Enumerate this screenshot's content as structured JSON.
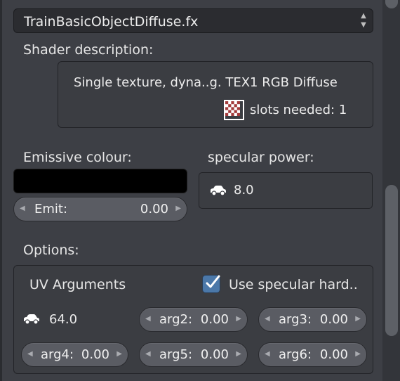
{
  "shader_dropdown": {
    "selected": "TrainBasicObjectDiffuse.fx",
    "arrows_up": "▲",
    "arrows_down": "▼"
  },
  "shader_description": {
    "label": "Shader description:",
    "text": "Single texture, dyna..g. TEX1 RGB Diffuse",
    "slots_text": "slots needed: 1"
  },
  "emissive": {
    "label": "Emissive colour:",
    "color": "#000000",
    "emit_label": "Emit:",
    "emit_value": "0.00"
  },
  "specular_power": {
    "label": "specular power:",
    "value": "8.0",
    "icon": "car-icon"
  },
  "options": {
    "label": "Options:",
    "uv_arguments_label": "UV Arguments",
    "use_specular_label": "Use specular hard..",
    "use_specular_checked": true,
    "arg1_value": "64.0",
    "arg2": {
      "label": "arg2:",
      "value": "0.00"
    },
    "arg3": {
      "label": "arg3:",
      "value": "0.00"
    },
    "arg4": {
      "label": "arg4:",
      "value": "0.00"
    },
    "arg5": {
      "label": "arg5:",
      "value": "0.00"
    },
    "arg6": {
      "label": "arg6:",
      "value": "0.00"
    }
  },
  "colors": {
    "panel_bg": "#3d3f45",
    "accent_checkbox": "#4b78a9",
    "pill_bg": "#5a5c63"
  }
}
